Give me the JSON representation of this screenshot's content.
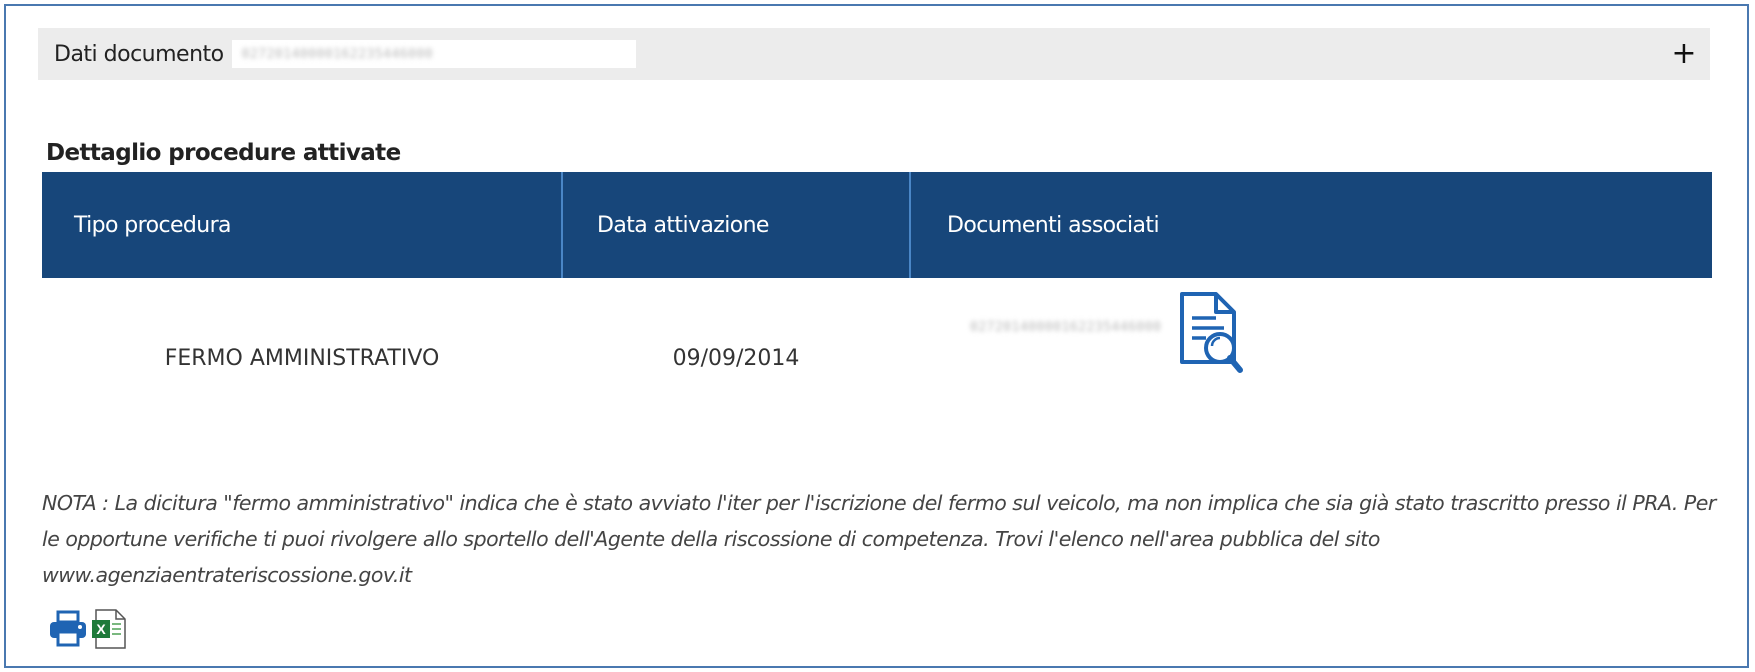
{
  "document_panel": {
    "title": "Dati documento",
    "document_id": "02720140000162235446000",
    "expand_symbol": "+"
  },
  "procedures": {
    "title": "Dettaglio procedure attivate",
    "columns": [
      "Tipo procedura",
      "Data attivazione",
      "Documenti associati"
    ],
    "rows": [
      {
        "tipo_procedura": "FERMO AMMINISTRATIVO",
        "data_attivazione": "09/09/2014",
        "documento": "02720140000162235446000",
        "icon": "document-search-icon"
      }
    ]
  },
  "note": {
    "text": "NOTA : La dicitura \"fermo amministrativo\" indica che è stato avviato l'iter per l'iscrizione del fermo sul veicolo, ma non implica che sia già stato trascritto presso il PRA. Per le opportune verifiche ti puoi rivolgere allo sportello dell'Agente della riscossione di competenza. Trovi l'elenco nell'area pubblica del sito www.agenziaentrateriscossione.gov.it"
  },
  "toolbar": {
    "icons": [
      "print-icon",
      "excel-export-icon"
    ]
  },
  "colors": {
    "header_bg": "#17467a",
    "header_divider": "#4a86c6",
    "panel_bg": "#ececec",
    "frame_border": "#4a78b0",
    "icon_blue": "#1f64b3"
  }
}
